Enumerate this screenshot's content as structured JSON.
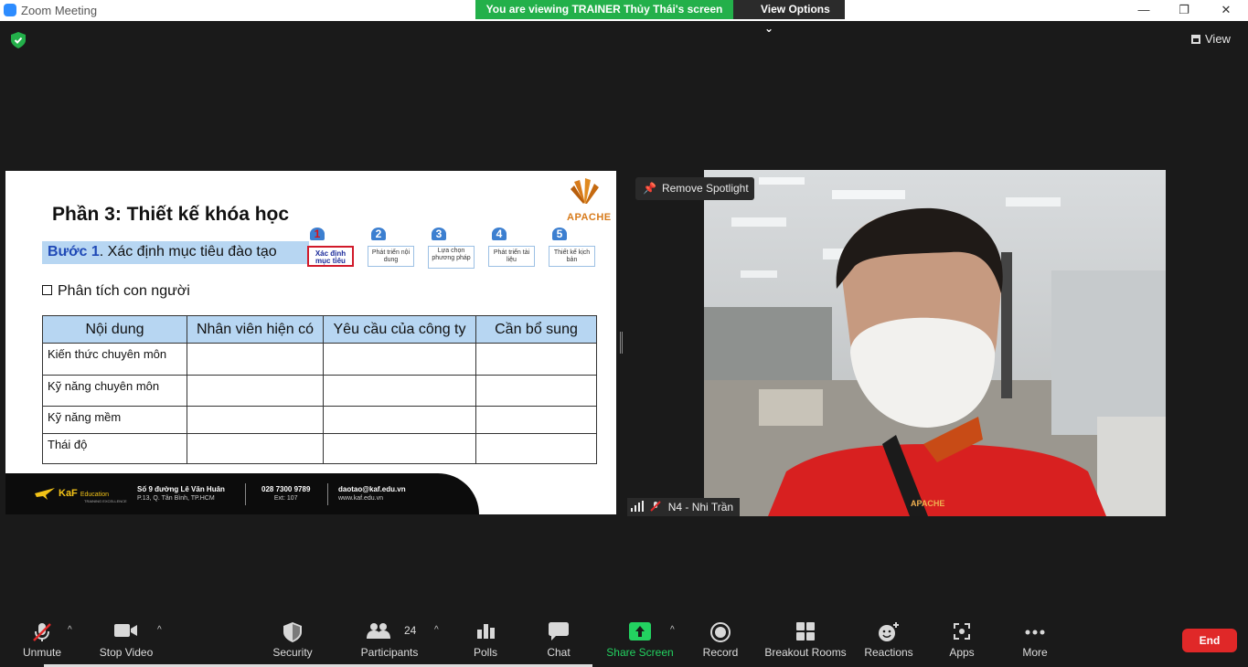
{
  "window": {
    "title": "Zoom Meeting",
    "controls": [
      "—",
      "❐",
      "✕"
    ]
  },
  "banner": {
    "viewing_text": "You are viewing TRAINER Thủy Thái's screen",
    "view_options": "View Options",
    "caret": "⌄"
  },
  "view_button": {
    "label": "View"
  },
  "slide": {
    "title": "Phần 3: Thiết kế khóa học",
    "logo_text": "APACHE",
    "step_bar": {
      "step_word": "Bước 1",
      "text": ". Xác định mục tiêu đào tạo"
    },
    "steps": [
      {
        "num": "1",
        "label": "Xác định mục tiêu"
      },
      {
        "num": "2",
        "label": "Phát triển nội dung"
      },
      {
        "num": "3",
        "label": "Lựa chọn phương pháp"
      },
      {
        "num": "4",
        "label": "Phát triển tài liệu"
      },
      {
        "num": "5",
        "label": "Thiết kế kịch bản"
      }
    ],
    "analysis_label": "Phân tích con người",
    "table": {
      "headers": [
        "Nội dung",
        "Nhân viên hiện có",
        "Yêu cầu của công ty",
        "Cần bổ sung"
      ],
      "rows": [
        [
          "Kiến thức chuyên môn",
          "",
          "",
          ""
        ],
        [
          "Kỹ năng chuyên môn",
          "",
          "",
          ""
        ],
        [
          "Kỹ năng mềm",
          "",
          "",
          ""
        ],
        [
          "Thái độ",
          "",
          "",
          ""
        ]
      ]
    },
    "footer": {
      "brand": "KaF",
      "brand_sub": "Education",
      "brand_tag": "TRAINING EXCELLENCE",
      "address": "Số 9 đường Lê Văn Huân",
      "address_sub": "P.13, Q. Tân Bình, TP.HCM",
      "phone": "028 7300 9789",
      "phone_sub": "Ext: 107",
      "email": "daotao@kaf.edu.vn",
      "web": "www.kaf.edu.vn"
    }
  },
  "video": {
    "remove_spotlight": "Remove Spotlight",
    "participant_name": "N4 - Nhi Trần",
    "shirt_text": "APACHE"
  },
  "toolbar": {
    "unmute": "Unmute",
    "stop_video": "Stop Video",
    "security": "Security",
    "participants": "Participants",
    "participant_count": "24",
    "polls": "Polls",
    "chat": "Chat",
    "share_screen": "Share Screen",
    "record": "Record",
    "breakout_rooms": "Breakout Rooms",
    "reactions": "Reactions",
    "apps": "Apps",
    "more": "More",
    "end": "End",
    "caret": "^"
  },
  "colors": {
    "banner_green": "#23b04a",
    "share_green": "#23d160",
    "end_red": "#e02828",
    "zoom_blue": "#2d8cff",
    "slide_blue": "#b7d6f2",
    "apache_orange": "#d77a1a"
  }
}
